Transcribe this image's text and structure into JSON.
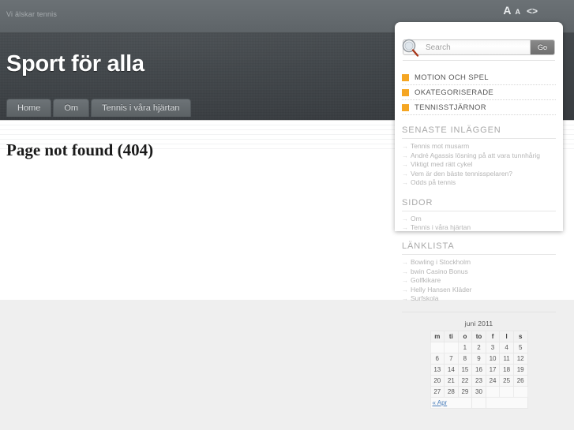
{
  "topbar": {
    "tagline": "Vi älskar tennis",
    "tools": {
      "font_large": "A",
      "font_small": "A",
      "code_toggle": "<>"
    }
  },
  "header": {
    "site_title": "Sport för alla"
  },
  "nav": {
    "items": [
      {
        "label": "Home"
      },
      {
        "label": "Om"
      },
      {
        "label": "Tennis i våra hjärtan"
      }
    ]
  },
  "main": {
    "page_title": "Page not found (404)"
  },
  "sidebar": {
    "search": {
      "placeholder": "Search",
      "value": "",
      "button_label": "Go"
    },
    "categories": {
      "swatch_color": "#f5a623",
      "items": [
        {
          "label": "MOTION OCH SPEL"
        },
        {
          "label": "OKATEGORISERADE"
        },
        {
          "label": "TENNISSTJÄRNOR"
        }
      ]
    },
    "recent_posts": {
      "heading": "SENASTE INLÄGGEN",
      "items": [
        {
          "label": "Tennis mot musarm"
        },
        {
          "label": "André Agassis lösning på att vara tunnhårig"
        },
        {
          "label": "Viktigt med rätt cykel"
        },
        {
          "label": "Vem är den bäste tennisspelaren?"
        },
        {
          "label": "Odds på tennis"
        }
      ]
    },
    "pages": {
      "heading": "SIDOR",
      "items": [
        {
          "label": "Om"
        },
        {
          "label": "Tennis i våra hjärtan"
        }
      ]
    },
    "links": {
      "heading": "LÄNKLISTA",
      "items": [
        {
          "label": "Bowling i Stockholm"
        },
        {
          "label": "bwin Casino Bonus"
        },
        {
          "label": "Golfkikare"
        },
        {
          "label": "Helly Hansen Kläder"
        },
        {
          "label": "Surfskola"
        }
      ]
    },
    "calendar": {
      "caption": "juni 2011",
      "weekdays": [
        "m",
        "ti",
        "o",
        "to",
        "f",
        "l",
        "s"
      ],
      "weeks": [
        [
          "",
          "",
          "1",
          "2",
          "3",
          "4",
          "5"
        ],
        [
          "6",
          "7",
          "8",
          "9",
          "10",
          "11",
          "12"
        ],
        [
          "13",
          "14",
          "15",
          "16",
          "17",
          "18",
          "19"
        ],
        [
          "20",
          "21",
          "22",
          "23",
          "24",
          "25",
          "26"
        ],
        [
          "27",
          "28",
          "29",
          "30",
          "",
          "",
          ""
        ]
      ],
      "prev_label": "« Apr"
    }
  }
}
